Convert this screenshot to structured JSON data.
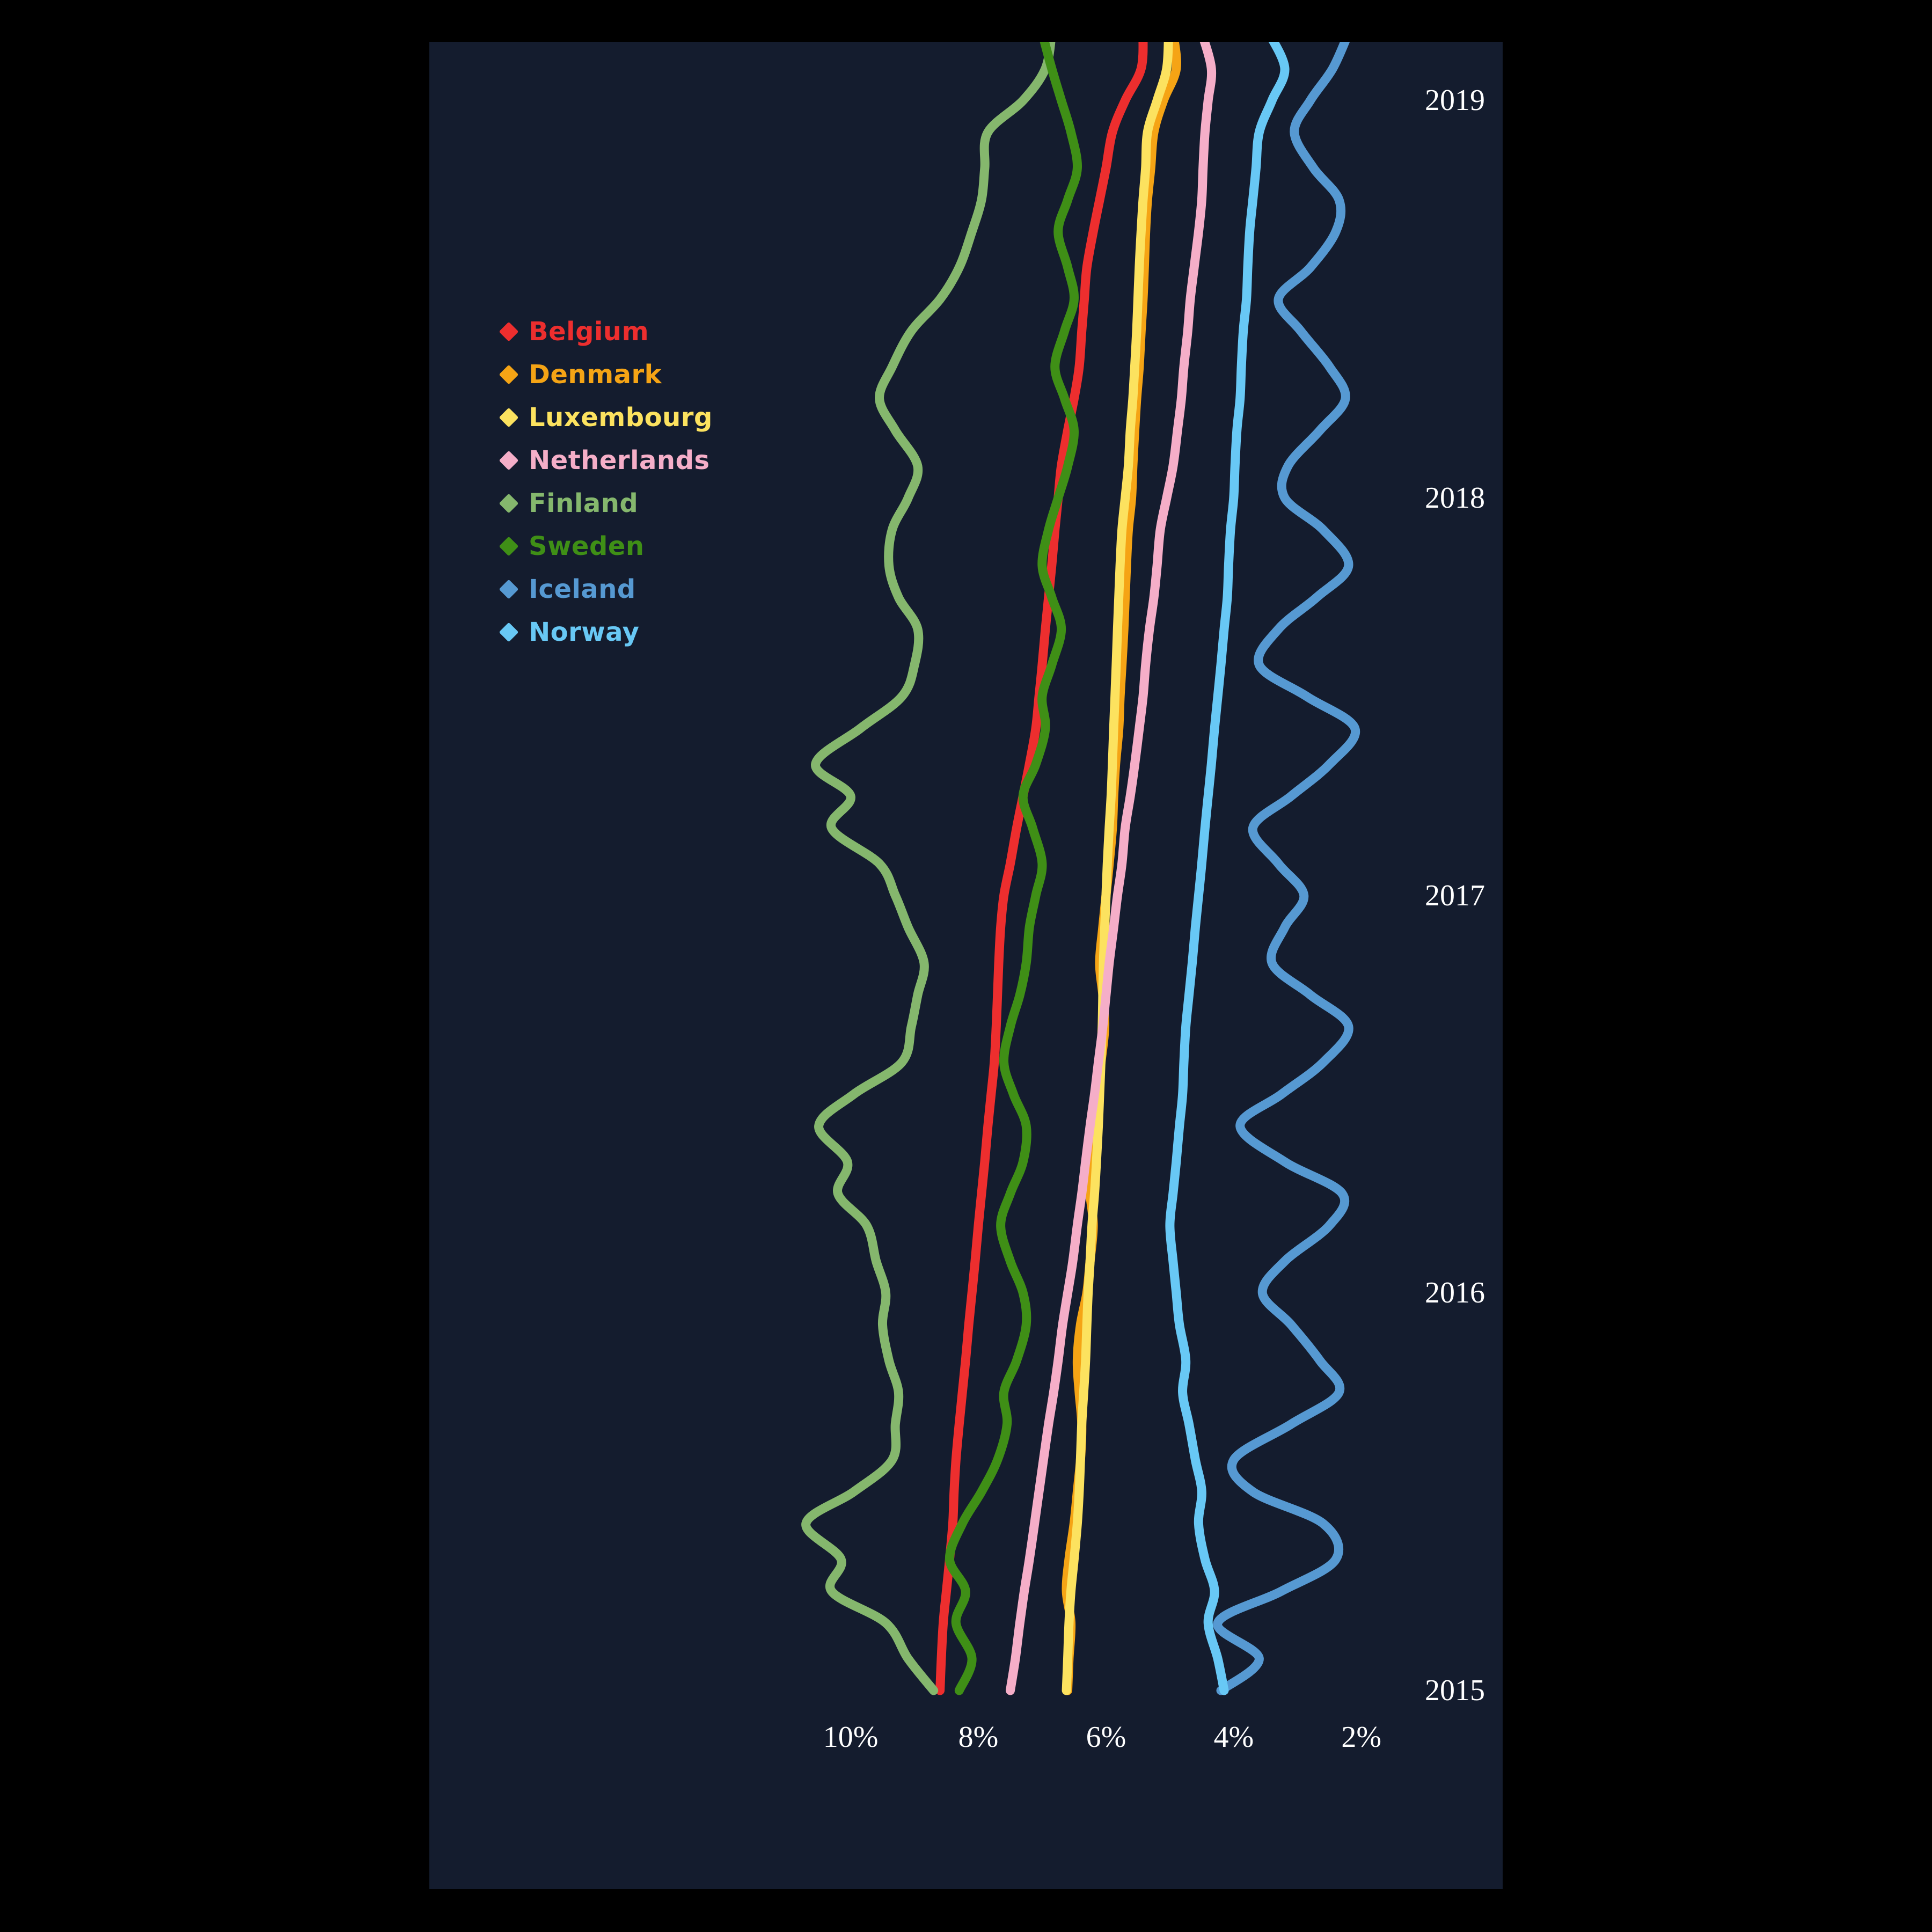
{
  "colors": {
    "background": "#000000",
    "panel": "#141c2e",
    "axis_text": "#ffffff"
  },
  "legend": {
    "items": [
      {
        "label": "Belgium",
        "color": "#ed2e2e"
      },
      {
        "label": "Denmark",
        "color": "#f5a415"
      },
      {
        "label": "Luxembourg",
        "color": "#fce25f"
      },
      {
        "label": "Netherlands",
        "color": "#f5aec8"
      },
      {
        "label": "Finland",
        "color": "#85b76d"
      },
      {
        "label": "Sweden",
        "color": "#3f8f16"
      },
      {
        "label": "Iceland",
        "color": "#5699d2"
      },
      {
        "label": "Norway",
        "color": "#68c8f5"
      }
    ]
  },
  "axes": {
    "x_ticks": [
      "10%",
      "8%",
      "6%",
      "4%",
      "2%"
    ],
    "x_tick_values": [
      10,
      8,
      6,
      4,
      2
    ],
    "y_ticks": [
      "2019",
      "2018",
      "2017",
      "2016",
      "2015"
    ],
    "y_tick_values": [
      2019,
      2018,
      2017,
      2016,
      2015
    ]
  },
  "chart_data": {
    "type": "line",
    "title": "",
    "subtitle": "",
    "xlabel": "",
    "ylabel": "",
    "orientation": "vertical-time",
    "x_axis_reversed": true,
    "xlim": [
      10.9,
      1.3
    ],
    "ylim": [
      2015.0,
      2019.25
    ],
    "grid": false,
    "legend_position": "upper-left",
    "x_tick_labels": [
      "10%",
      "8%",
      "6%",
      "4%",
      "2%"
    ],
    "y_tick_labels": [
      "2019",
      "2018",
      "2017",
      "2016",
      "2015"
    ],
    "note": "Monthly unemployment rate by country; time runs bottom (2015) to top (2019); percent axis is reversed (10% left to 2% right).",
    "series": [
      {
        "name": "Belgium",
        "color": "#ed2e2e",
        "t": [
          2015.0,
          2015.08,
          2015.17,
          2015.25,
          2015.33,
          2015.42,
          2015.5,
          2015.58,
          2015.67,
          2015.75,
          2015.83,
          2015.92,
          2016.0,
          2016.08,
          2016.17,
          2016.25,
          2016.33,
          2016.42,
          2016.5,
          2016.58,
          2016.67,
          2016.75,
          2016.83,
          2016.92,
          2017.0,
          2017.08,
          2017.17,
          2017.25,
          2017.33,
          2017.42,
          2017.5,
          2017.58,
          2017.67,
          2017.75,
          2017.83,
          2017.92,
          2018.0,
          2018.08,
          2018.17,
          2018.25,
          2018.33,
          2018.42,
          2018.5,
          2018.58,
          2018.67,
          2018.75,
          2018.83,
          2018.92,
          2019.0,
          2019.08,
          2019.17
        ],
        "v": [
          8.6,
          8.58,
          8.55,
          8.5,
          8.45,
          8.4,
          8.38,
          8.35,
          8.3,
          8.25,
          8.2,
          8.15,
          8.1,
          8.05,
          8.0,
          7.95,
          7.9,
          7.85,
          7.8,
          7.75,
          7.72,
          7.7,
          7.68,
          7.65,
          7.6,
          7.5,
          7.4,
          7.3,
          7.2,
          7.1,
          7.05,
          7.0,
          6.95,
          6.9,
          6.85,
          6.8,
          6.75,
          6.7,
          6.6,
          6.5,
          6.42,
          6.38,
          6.34,
          6.3,
          6.2,
          6.1,
          6.0,
          5.9,
          5.7,
          5.45,
          5.42
        ]
      },
      {
        "name": "Denmark",
        "color": "#f5a415",
        "t": [
          2015.0,
          2015.08,
          2015.17,
          2015.25,
          2015.33,
          2015.42,
          2015.5,
          2015.58,
          2015.67,
          2015.75,
          2015.83,
          2015.92,
          2016.0,
          2016.08,
          2016.17,
          2016.25,
          2016.33,
          2016.42,
          2016.5,
          2016.58,
          2016.67,
          2016.75,
          2016.83,
          2016.92,
          2017.0,
          2017.08,
          2017.17,
          2017.25,
          2017.33,
          2017.42,
          2017.5,
          2017.58,
          2017.67,
          2017.75,
          2017.83,
          2017.92,
          2018.0,
          2018.08,
          2018.17,
          2018.25,
          2018.33,
          2018.42,
          2018.5,
          2018.58,
          2018.67,
          2018.75,
          2018.83,
          2018.92,
          2019.0,
          2019.08,
          2019.17
        ],
        "v": [
          6.6,
          6.58,
          6.55,
          6.62,
          6.58,
          6.5,
          6.45,
          6.4,
          6.38,
          6.42,
          6.45,
          6.4,
          6.3,
          6.25,
          6.2,
          6.25,
          6.28,
          6.22,
          6.15,
          6.08,
          6.02,
          6.05,
          6.1,
          6.05,
          6.0,
          5.95,
          5.9,
          5.88,
          5.85,
          5.8,
          5.78,
          5.75,
          5.72,
          5.7,
          5.68,
          5.65,
          5.6,
          5.58,
          5.55,
          5.52,
          5.48,
          5.45,
          5.42,
          5.4,
          5.38,
          5.35,
          5.3,
          5.25,
          5.1,
          4.9,
          4.95
        ]
      },
      {
        "name": "Luxembourg",
        "color": "#fce25f",
        "t": [
          2015.0,
          2015.08,
          2015.17,
          2015.25,
          2015.33,
          2015.42,
          2015.5,
          2015.58,
          2015.67,
          2015.75,
          2015.83,
          2015.92,
          2016.0,
          2016.08,
          2016.17,
          2016.25,
          2016.33,
          2016.42,
          2016.5,
          2016.58,
          2016.67,
          2016.75,
          2016.83,
          2016.92,
          2017.0,
          2017.08,
          2017.17,
          2017.25,
          2017.33,
          2017.42,
          2017.5,
          2017.58,
          2017.67,
          2017.75,
          2017.83,
          2017.92,
          2018.0,
          2018.08,
          2018.17,
          2018.25,
          2018.33,
          2018.42,
          2018.5,
          2018.58,
          2018.67,
          2018.75,
          2018.83,
          2018.92,
          2019.0,
          2019.08,
          2019.17
        ],
        "v": [
          6.62,
          6.6,
          6.58,
          6.55,
          6.5,
          6.45,
          6.42,
          6.4,
          6.38,
          6.35,
          6.32,
          6.3,
          6.28,
          6.25,
          6.22,
          6.18,
          6.15,
          6.12,
          6.1,
          6.08,
          6.06,
          6.05,
          6.04,
          6.02,
          6.0,
          5.98,
          5.95,
          5.92,
          5.9,
          5.88,
          5.86,
          5.84,
          5.82,
          5.8,
          5.78,
          5.75,
          5.7,
          5.65,
          5.62,
          5.58,
          5.55,
          5.52,
          5.5,
          5.48,
          5.45,
          5.42,
          5.38,
          5.35,
          5.2,
          5.05,
          5.02
        ]
      },
      {
        "name": "Netherlands",
        "color": "#f5aec8",
        "t": [
          2015.0,
          2015.08,
          2015.17,
          2015.25,
          2015.33,
          2015.42,
          2015.5,
          2015.58,
          2015.67,
          2015.75,
          2015.83,
          2015.92,
          2016.0,
          2016.08,
          2016.17,
          2016.25,
          2016.33,
          2016.42,
          2016.5,
          2016.58,
          2016.67,
          2016.75,
          2016.83,
          2016.92,
          2017.0,
          2017.08,
          2017.17,
          2017.25,
          2017.33,
          2017.42,
          2017.5,
          2017.58,
          2017.67,
          2017.75,
          2017.83,
          2017.92,
          2018.0,
          2018.08,
          2018.17,
          2018.25,
          2018.33,
          2018.42,
          2018.5,
          2018.58,
          2018.67,
          2018.75,
          2018.83,
          2018.92,
          2019.0,
          2019.08,
          2019.17
        ],
        "v": [
          7.5,
          7.42,
          7.35,
          7.28,
          7.2,
          7.12,
          7.05,
          6.98,
          6.9,
          6.82,
          6.75,
          6.68,
          6.6,
          6.52,
          6.45,
          6.38,
          6.32,
          6.25,
          6.18,
          6.12,
          6.05,
          6.0,
          5.95,
          5.88,
          5.82,
          5.75,
          5.7,
          5.62,
          5.55,
          5.48,
          5.42,
          5.38,
          5.32,
          5.25,
          5.2,
          5.15,
          5.05,
          4.95,
          4.88,
          4.82,
          4.78,
          4.72,
          4.68,
          4.62,
          4.55,
          4.5,
          4.48,
          4.45,
          4.4,
          4.35,
          4.5
        ]
      },
      {
        "name": "Finland",
        "color": "#85b76d",
        "t": [
          2015.0,
          2015.08,
          2015.17,
          2015.25,
          2015.33,
          2015.42,
          2015.5,
          2015.58,
          2015.67,
          2015.75,
          2015.83,
          2015.92,
          2016.0,
          2016.08,
          2016.17,
          2016.25,
          2016.33,
          2016.42,
          2016.5,
          2016.58,
          2016.67,
          2016.75,
          2016.83,
          2016.92,
          2017.0,
          2017.08,
          2017.17,
          2017.25,
          2017.33,
          2017.42,
          2017.5,
          2017.58,
          2017.67,
          2017.75,
          2017.83,
          2017.92,
          2018.0,
          2018.08,
          2018.17,
          2018.25,
          2018.33,
          2018.42,
          2018.5,
          2018.58,
          2018.67,
          2018.75,
          2018.83,
          2018.92,
          2019.0,
          2019.08,
          2019.17
        ],
        "v": [
          8.7,
          9.1,
          9.45,
          10.3,
          10.15,
          10.7,
          9.95,
          9.35,
          9.3,
          9.25,
          9.4,
          9.5,
          9.45,
          9.6,
          9.75,
          10.2,
          10.05,
          10.5,
          9.95,
          9.2,
          9.05,
          8.95,
          8.85,
          9.1,
          9.3,
          9.55,
          10.3,
          10.0,
          10.55,
          9.85,
          9.2,
          9.0,
          8.95,
          9.25,
          9.4,
          9.35,
          9.1,
          8.95,
          9.3,
          9.55,
          9.35,
          9.05,
          8.6,
          8.3,
          8.1,
          7.95,
          7.9,
          7.85,
          7.3,
          6.95,
          6.85
        ]
      },
      {
        "name": "Sweden",
        "color": "#3f8f16",
        "t": [
          2015.0,
          2015.08,
          2015.17,
          2015.25,
          2015.33,
          2015.42,
          2015.5,
          2015.58,
          2015.67,
          2015.75,
          2015.83,
          2015.92,
          2016.0,
          2016.08,
          2016.17,
          2016.25,
          2016.33,
          2016.42,
          2016.5,
          2016.58,
          2016.67,
          2016.75,
          2016.83,
          2016.92,
          2017.0,
          2017.08,
          2017.17,
          2017.25,
          2017.33,
          2017.42,
          2017.5,
          2017.58,
          2017.67,
          2017.75,
          2017.83,
          2017.92,
          2018.0,
          2018.08,
          2018.17,
          2018.25,
          2018.33,
          2018.42,
          2018.5,
          2018.58,
          2018.67,
          2018.75,
          2018.83,
          2018.92,
          2019.0,
          2019.08,
          2019.17
        ],
        "v": [
          8.3,
          8.1,
          8.35,
          8.2,
          8.45,
          8.25,
          7.95,
          7.7,
          7.55,
          7.6,
          7.4,
          7.25,
          7.3,
          7.5,
          7.65,
          7.5,
          7.3,
          7.25,
          7.45,
          7.6,
          7.5,
          7.35,
          7.25,
          7.2,
          7.1,
          7.0,
          7.15,
          7.3,
          7.1,
          6.95,
          7.0,
          6.85,
          6.7,
          6.85,
          7.0,
          6.9,
          6.75,
          6.6,
          6.5,
          6.65,
          6.8,
          6.65,
          6.5,
          6.6,
          6.75,
          6.6,
          6.45,
          6.55,
          6.7,
          6.85,
          7.0
        ]
      },
      {
        "name": "Iceland",
        "color": "#5699d2",
        "t": [
          2015.0,
          2015.08,
          2015.17,
          2015.25,
          2015.33,
          2015.42,
          2015.5,
          2015.58,
          2015.67,
          2015.75,
          2015.83,
          2015.92,
          2016.0,
          2016.08,
          2016.17,
          2016.25,
          2016.33,
          2016.42,
          2016.5,
          2016.58,
          2016.67,
          2016.75,
          2016.83,
          2016.92,
          2017.0,
          2017.08,
          2017.17,
          2017.25,
          2017.33,
          2017.42,
          2017.5,
          2017.58,
          2017.67,
          2017.75,
          2017.83,
          2017.92,
          2018.0,
          2018.08,
          2018.17,
          2018.25,
          2018.33,
          2018.42,
          2018.5,
          2018.58,
          2018.67,
          2018.75,
          2018.83,
          2018.92,
          2019.0,
          2019.08,
          2019.17
        ],
        "v": [
          4.2,
          3.6,
          4.25,
          3.25,
          2.4,
          2.6,
          3.7,
          4.0,
          3.1,
          2.35,
          2.65,
          3.1,
          3.55,
          3.2,
          2.5,
          2.3,
          3.2,
          3.9,
          3.25,
          2.6,
          2.2,
          2.8,
          3.4,
          3.2,
          2.9,
          3.3,
          3.7,
          3.1,
          2.5,
          2.1,
          2.85,
          3.6,
          3.3,
          2.7,
          2.2,
          2.6,
          3.2,
          3.15,
          2.65,
          2.25,
          2.5,
          2.95,
          3.3,
          2.8,
          2.4,
          2.35,
          2.75,
          3.05,
          2.8,
          2.45,
          2.2
        ]
      },
      {
        "name": "Norway",
        "color": "#68c8f5",
        "t": [
          2015.0,
          2015.08,
          2015.17,
          2015.25,
          2015.33,
          2015.42,
          2015.5,
          2015.58,
          2015.67,
          2015.75,
          2015.83,
          2015.92,
          2016.0,
          2016.08,
          2016.17,
          2016.25,
          2016.33,
          2016.42,
          2016.5,
          2016.58,
          2016.67,
          2016.75,
          2016.83,
          2016.92,
          2017.0,
          2017.08,
          2017.17,
          2017.25,
          2017.33,
          2017.42,
          2017.5,
          2017.58,
          2017.67,
          2017.75,
          2017.83,
          2017.92,
          2018.0,
          2018.08,
          2018.17,
          2018.25,
          2018.33,
          2018.42,
          2018.5,
          2018.58,
          2018.67,
          2018.75,
          2018.83,
          2018.92,
          2019.0,
          2019.08,
          2019.17
        ],
        "v": [
          4.15,
          4.25,
          4.4,
          4.3,
          4.45,
          4.55,
          4.5,
          4.6,
          4.7,
          4.8,
          4.75,
          4.85,
          4.9,
          4.95,
          5.0,
          4.95,
          4.9,
          4.85,
          4.8,
          4.78,
          4.75,
          4.7,
          4.65,
          4.6,
          4.55,
          4.5,
          4.45,
          4.4,
          4.35,
          4.3,
          4.25,
          4.2,
          4.15,
          4.1,
          4.08,
          4.05,
          4.0,
          3.98,
          3.95,
          3.9,
          3.88,
          3.85,
          3.8,
          3.78,
          3.75,
          3.7,
          3.65,
          3.6,
          3.4,
          3.2,
          3.45
        ]
      }
    ]
  }
}
